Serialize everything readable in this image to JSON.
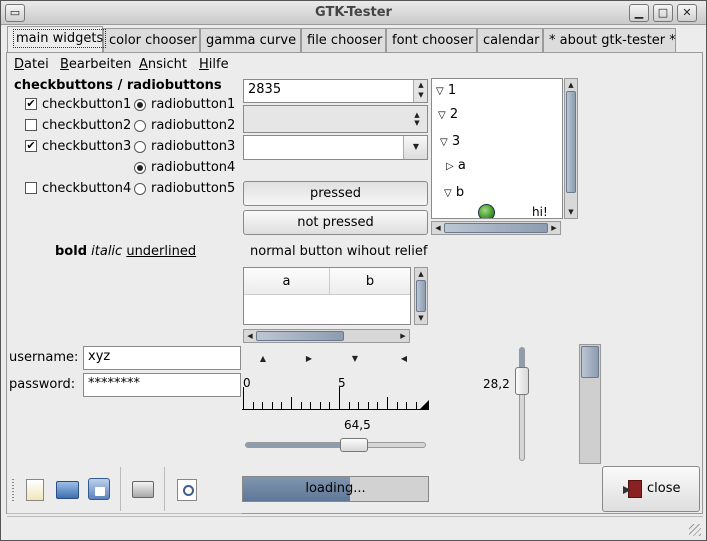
{
  "window": {
    "title": "GTK-Tester"
  },
  "tabs": [
    "main widgets",
    "color chooser",
    "gamma curve",
    "file chooser",
    "font chooser",
    "calendar",
    "* about gtk-tester *"
  ],
  "menu": [
    {
      "label": "Datei",
      "mnemonic": "D"
    },
    {
      "label": "Bearbeiten",
      "mnemonic": "B"
    },
    {
      "label": "Ansicht",
      "mnemonic": "A"
    },
    {
      "label": "Hilfe",
      "mnemonic": "H"
    }
  ],
  "checks": {
    "heading": "checkbuttons / radiobuttons",
    "checkbuttons": [
      {
        "label": "checkbutton1",
        "checked": true
      },
      {
        "label": "checkbutton2",
        "checked": false
      },
      {
        "label": "checkbutton3",
        "checked": true
      },
      {
        "label": "checkbutton4",
        "checked": false
      }
    ],
    "radiobuttons": [
      {
        "label": "radiobutton1",
        "selected": true
      },
      {
        "label": "radiobutton2",
        "selected": false
      },
      {
        "label": "radiobutton3",
        "selected": false
      },
      {
        "label": "radiobutton4",
        "selected": true
      },
      {
        "label": "radiobutton5",
        "selected": false
      }
    ]
  },
  "styled_text": {
    "bold": "bold",
    "italic": "italic",
    "underlined": "underlined"
  },
  "spin": {
    "value": "2835"
  },
  "buttons": {
    "pressed": "pressed",
    "not_pressed": "not pressed",
    "no_relief": "normal button wihout relief",
    "close": "close"
  },
  "tree": {
    "nodes": [
      "1",
      "2",
      "3",
      "a",
      "b"
    ],
    "partial": "hi!"
  },
  "list": {
    "columns": [
      "a",
      "b"
    ]
  },
  "login": {
    "username_label": "username:",
    "username": "xyz",
    "password_label": "password:",
    "password": "********"
  },
  "ruler": {
    "labels": [
      "0",
      "5"
    ]
  },
  "hscale": {
    "value": "64,5",
    "fraction": 0.6
  },
  "vscale": {
    "value": "28,2",
    "fraction": 0.3
  },
  "progress": {
    "text": "loading...",
    "fraction": 0.58
  },
  "toolbar": [
    "new-icon",
    "open-icon",
    "save-icon",
    "print-icon",
    "print-preview-icon"
  ]
}
